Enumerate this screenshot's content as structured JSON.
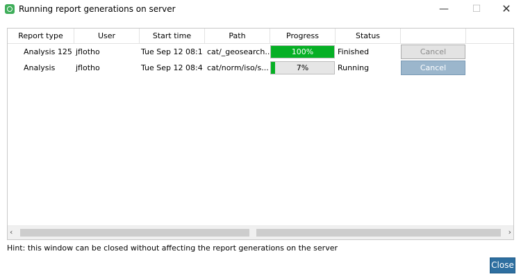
{
  "window": {
    "title": "Running report generations on server",
    "minimize": "—",
    "maximize": "☐",
    "close": "✕"
  },
  "table": {
    "headers": [
      "Report type",
      "User",
      "Start time",
      "Path",
      "Progress",
      "Status",
      ""
    ],
    "rows": [
      {
        "report_type": "Analysis 125",
        "user": "jflotho",
        "start_time": "Tue Sep 12 08:1...",
        "path": "cat/_geosearch...",
        "progress_text": "100%",
        "progress_fraction": 1.0,
        "status": "Finished",
        "cancel": "Cancel"
      },
      {
        "report_type": "Analysis",
        "user": "jflotho",
        "start_time": "Tue Sep 12 08:4...",
        "path": "cat/norm/iso/s...",
        "progress_text": "7%",
        "progress_fraction": 0.07,
        "status": "Running",
        "cancel": "Cancel"
      }
    ]
  },
  "scrollbar": {
    "left": "‹",
    "right": "›"
  },
  "hint": "Hint: this window can be closed without affecting the report generations on the server",
  "close_label": "Close",
  "colors": {
    "progress": "#06b025",
    "close_button": "#2e6fa0"
  }
}
